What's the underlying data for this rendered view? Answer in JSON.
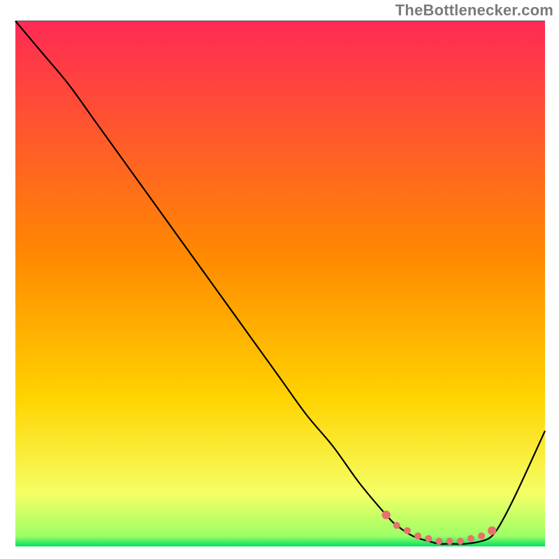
{
  "attribution": "TheBottlenecker.com",
  "colors": {
    "bg_top": "#ff2a55",
    "bg_mid": "#ffd400",
    "bg_bottom": "#00e060",
    "curve": "#000000",
    "marker": "#e8716f",
    "plot_border_top": "#555555"
  },
  "chart_data": {
    "type": "line",
    "title": "",
    "xlabel": "",
    "ylabel": "",
    "xlim": [
      0,
      100
    ],
    "ylim": [
      0,
      100
    ],
    "grid": false,
    "legend": null,
    "series": [
      {
        "name": "bottleneck-curve",
        "x": [
          0,
          5,
          10,
          15,
          20,
          25,
          30,
          35,
          40,
          45,
          50,
          55,
          60,
          65,
          70,
          72,
          75,
          78,
          80,
          82,
          85,
          88,
          90,
          92,
          95,
          100
        ],
        "y": [
          100,
          94,
          88,
          81,
          74,
          67,
          60,
          53,
          46,
          39,
          32,
          25,
          19,
          12,
          6,
          4,
          2,
          1,
          0.5,
          0.5,
          0.5,
          1,
          2,
          5,
          11,
          22
        ]
      }
    ],
    "markers": {
      "name": "sweet-spot",
      "x": [
        70,
        72,
        74,
        76,
        78,
        80,
        82,
        84,
        86,
        88,
        90
      ],
      "y": [
        6,
        4,
        3,
        2,
        1.5,
        1,
        1,
        1,
        1.5,
        2,
        3
      ]
    }
  }
}
